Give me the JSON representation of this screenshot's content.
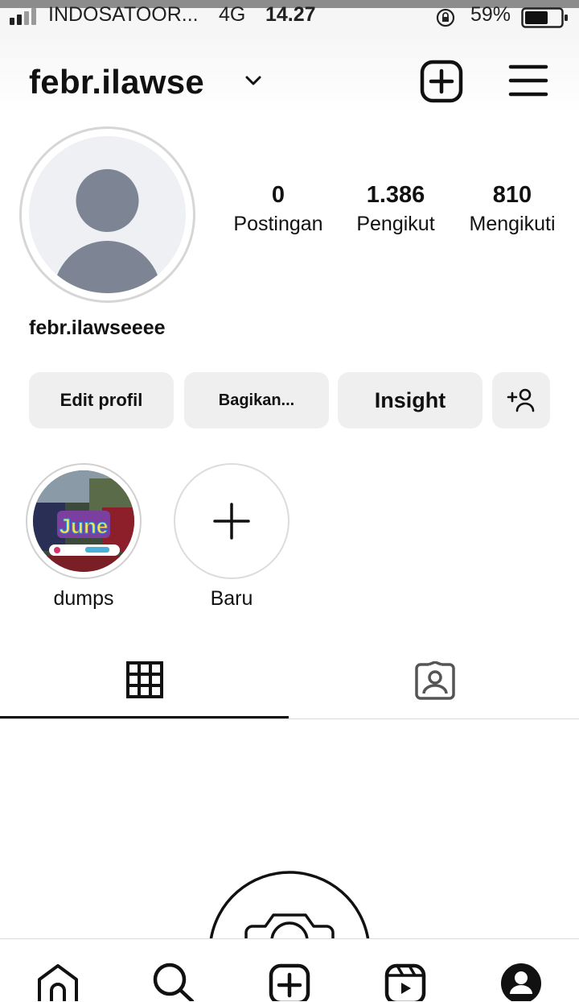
{
  "status_bar": {
    "carrier": "INDOSATOOR...",
    "network": "4G",
    "time": "14.27",
    "battery": "59%"
  },
  "header": {
    "username": "febr.ilawse"
  },
  "profile": {
    "stats": [
      {
        "value": "0",
        "label": "Postingan"
      },
      {
        "value": "1.386",
        "label": "Pengikut"
      },
      {
        "value": "810",
        "label": "Mengikuti"
      }
    ],
    "display_name": "febr.ilawseeee"
  },
  "actions": {
    "edit": "Edit profil",
    "share": "Bagikan...",
    "insight": "Insight"
  },
  "highlights": [
    {
      "label": "dumps",
      "cover_text": "June"
    },
    {
      "label": "Baru"
    }
  ],
  "icons": {
    "header": [
      "new-post-icon",
      "menu-icon"
    ],
    "tabs": [
      "grid-icon",
      "tagged-icon"
    ],
    "bottom_nav": [
      "home-icon",
      "search-icon",
      "create-icon",
      "reels-icon",
      "profile-icon"
    ]
  }
}
